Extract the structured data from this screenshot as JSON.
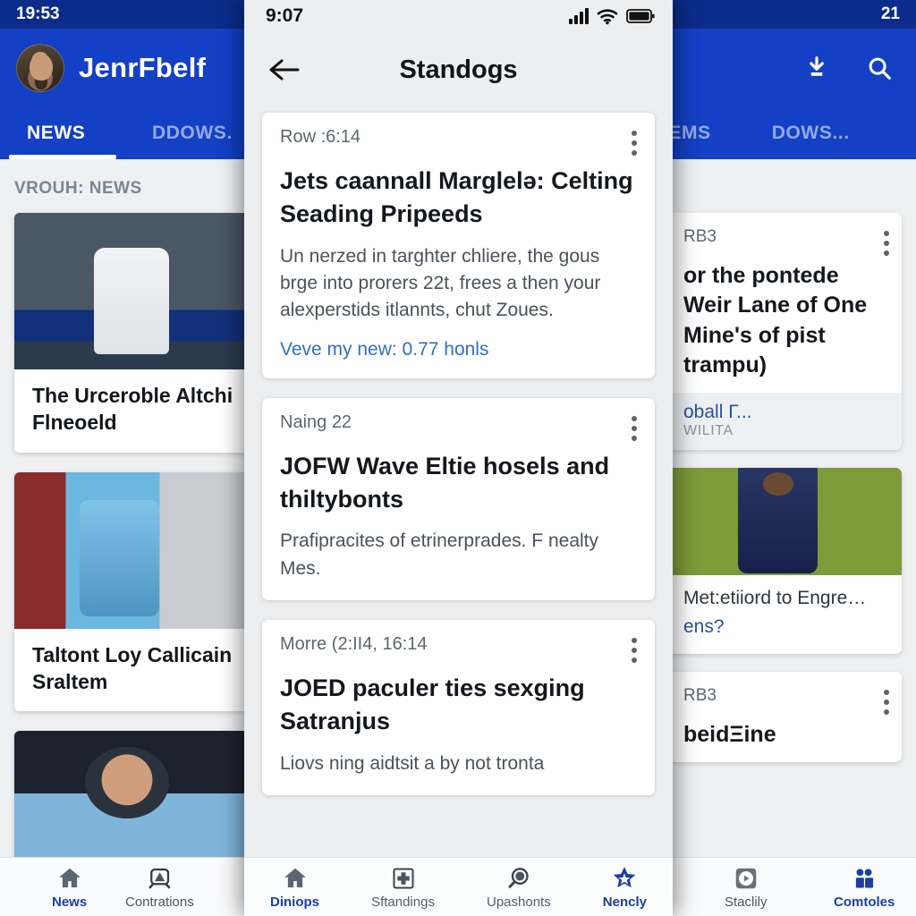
{
  "background_app": {
    "status_bar": {
      "time": "19:53",
      "right_text": "21"
    },
    "app_bar": {
      "title": "JenrFbelf",
      "avatar_name": "user-avatar",
      "download_icon": "download-icon",
      "search_icon": "search-icon",
      "gear_icon": "gear-icon"
    },
    "tabs": [
      {
        "label": "NEWS",
        "selected": true
      },
      {
        "label": "DDOWS.",
        "selected": false
      },
      {
        "label": "SERIEMS",
        "selected": false
      },
      {
        "label": "DOWS...",
        "selected": false
      }
    ],
    "section_label": "VROUH: NEWS",
    "left_cards": [
      {
        "title_line1": "The Urceroble Altchi",
        "title_line2": "Flneoeld"
      },
      {
        "title_line1": "Taltont Loy Callicain",
        "title_line2": "Sraltem"
      },
      {
        "title_line1": "",
        "title_line2": ""
      }
    ],
    "right_cards": [
      {
        "source": "RB3",
        "title_lines": [
          "or the pontede",
          "Weir Lane of One",
          "Mine's of pist",
          "trampu)"
        ],
        "link": "oball Г...",
        "sub": "WILITA"
      },
      {
        "caption": "Met:etiiord to Engre…",
        "question": "ens?"
      },
      {
        "source": "RB3",
        "title_lines": [
          "beidΞine"
        ]
      }
    ],
    "bottom_nav": [
      {
        "label": "News",
        "icon": "home-icon",
        "selected": true
      },
      {
        "label": "Contrations",
        "icon": "compass-icon",
        "selected": false
      },
      {
        "label": "Staclily",
        "icon": "play-circle-icon",
        "selected": false
      },
      {
        "label": "Comtoles",
        "icon": "people-icon",
        "selected": true
      }
    ]
  },
  "overlay": {
    "status_bar": {
      "time": "9:07",
      "signal_icon": "signal-bars-icon",
      "wifi_icon": "wifi-icon",
      "battery_icon": "battery-icon"
    },
    "app_bar": {
      "back_icon": "back-arrow-icon",
      "title": "Standogs"
    },
    "cards": [
      {
        "meta": "Row :6:14",
        "headline": "Jets caannall Marglelə: Celting Seading Pripeeds",
        "body": "Un nerzed in targhter chliere, the gous brge into prorers 22t, frees a then your alexperstids itlannts, chut Zoues.",
        "link": "Veve my new: 0.77 honls",
        "menu_icon": "kebab-menu-icon"
      },
      {
        "meta": "Naing 22",
        "headline": "JOFW Wave Eltie hosels and thiltybonts",
        "body": "Prafipracites of etrinerprades. F nealty Mes.",
        "link": "",
        "menu_icon": "kebab-menu-icon"
      },
      {
        "meta": "Morre (2:II4, 16:14",
        "headline": "JOED paculer ties sexging Satranjus",
        "body": "Liovs ning aidtsit a by not tronta",
        "link": "",
        "menu_icon": "kebab-menu-icon"
      }
    ],
    "bottom_nav": [
      {
        "label": "Diniops",
        "icon": "home-icon",
        "selected": true
      },
      {
        "label": "Sftandings",
        "icon": "plus-box-icon",
        "selected": false
      },
      {
        "label": "Upashonts",
        "icon": "search-circle-icon",
        "selected": false
      },
      {
        "label": "Nencly",
        "icon": "star-icon",
        "selected": true
      }
    ]
  },
  "colors": {
    "brand_blue": "#1340c4",
    "status_blue": "#0b2c8a",
    "link_blue": "#2f6fc4",
    "nav_selected": "#1a3fa0",
    "page_bg": "#eceef0"
  }
}
